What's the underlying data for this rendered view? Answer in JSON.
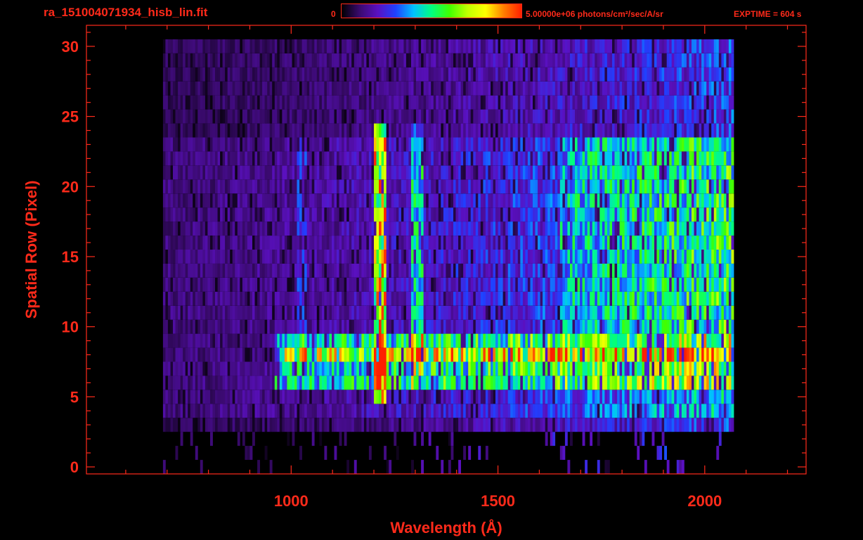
{
  "header": {
    "file_title": "ra_151004071934_hisb_lin.fit",
    "colorbar_min": "0",
    "colorbar_max": "5.00000e+06 photons/cm²/sec/A/sr",
    "exptime": "EXPTIME = 604 s"
  },
  "colors": {
    "axis": "#ff2a1a",
    "background": "#000000",
    "colormap": [
      "#000000",
      "#3a0a6e",
      "#5a10c0",
      "#2040ff",
      "#00c0ff",
      "#00ff80",
      "#40ff00",
      "#c0ff00",
      "#ffff00",
      "#ff8000",
      "#ff2000"
    ]
  },
  "chart_data": {
    "type": "heatmap",
    "xlabel": "Wavelength (Å)",
    "ylabel": "Spatial Row (Pixel)",
    "xlim": [
      505,
      2245
    ],
    "ylim": [
      -0.5,
      31.5
    ],
    "x_ticks": [
      1000,
      1500,
      2000
    ],
    "y_ticks": [
      0,
      5,
      10,
      15,
      20,
      25,
      30
    ],
    "value_units": "photons/cm²/sec/A/sr",
    "value_range": [
      0,
      5000000
    ],
    "wavelength_coverage": [
      690,
      2065
    ],
    "bright_line_features_A": [
      1025,
      1216,
      1304
    ],
    "notes": [
      {
        "feature": "broad bright horizontal band",
        "rows": [
          6,
          9
        ],
        "wavelength_range": [
          960,
          2065
        ]
      },
      {
        "feature": "bright vertical line",
        "wavelength": 1216,
        "rows": [
          5,
          24
        ]
      },
      {
        "feature": "secondary vertical line",
        "wavelength": 1304,
        "rows": [
          6,
          24
        ]
      },
      {
        "feature": "faint vertical line",
        "wavelength": 1025,
        "rows": [
          8,
          23
        ]
      }
    ]
  },
  "axes": {
    "x_tick_labels": [
      "1000",
      "1500",
      "2000"
    ],
    "y_tick_labels": [
      "0",
      "5",
      "10",
      "15",
      "20",
      "25",
      "30"
    ]
  }
}
